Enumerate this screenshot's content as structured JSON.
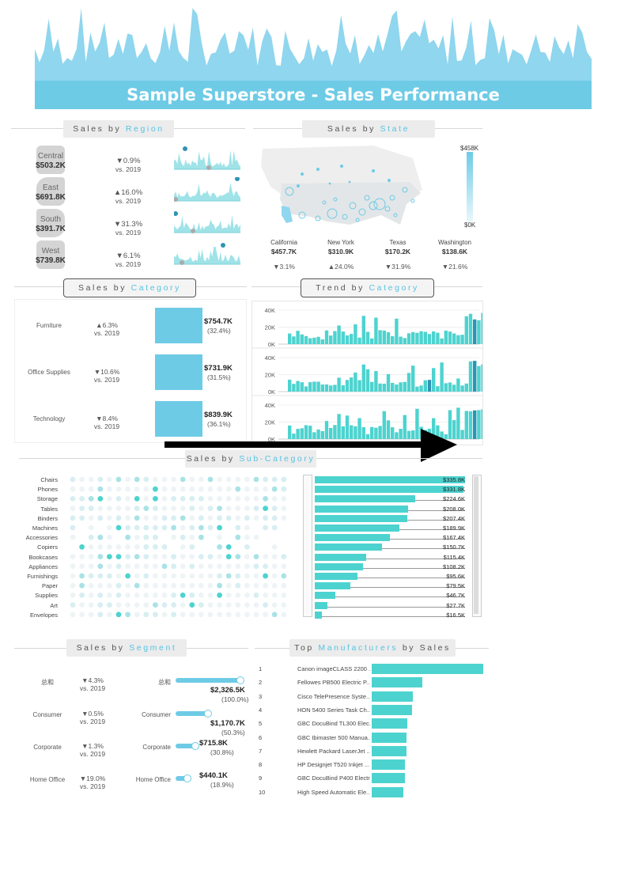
{
  "header": {
    "title": "Sample Superstore - Sales Performance"
  },
  "region": {
    "pill": {
      "a": "Sales  by ",
      "b": "Region"
    },
    "items": [
      {
        "name": "Central",
        "value": "$503.2K",
        "change": "▼0.9%",
        "dir": "down",
        "vs": "vs. 2019"
      },
      {
        "name": "East",
        "value": "$691.8K",
        "change": "▲16.0%",
        "dir": "up",
        "vs": "vs. 2019"
      },
      {
        "name": "South",
        "value": "$391.7K",
        "change": "▼31.3%",
        "dir": "down",
        "vs": "vs. 2019"
      },
      {
        "name": "West",
        "value": "$739.8K",
        "change": "▼6.1%",
        "dir": "down",
        "vs": "vs. 2019"
      }
    ]
  },
  "state": {
    "pill": {
      "a": "Sales  by ",
      "b": "State"
    },
    "legend_max": "$458K",
    "legend_min": "$0K",
    "items": [
      {
        "name": "California",
        "value": "$457.7K",
        "change": "▼3.1%",
        "dir": "down"
      },
      {
        "name": "New York",
        "value": "$310.9K",
        "change": "▲24.0%",
        "dir": "up"
      },
      {
        "name": "Texas",
        "value": "$170.2K",
        "change": "▼31.9%",
        "dir": "down"
      },
      {
        "name": "Washington",
        "value": "$138.6K",
        "change": "▼21.6%",
        "dir": "down"
      }
    ]
  },
  "category": {
    "pill": {
      "a": "Sales  by ",
      "b": "Category"
    },
    "items": [
      {
        "name": "Furniture",
        "change": "▲6.3%",
        "dir": "up",
        "vs": "vs. 2019",
        "value": "$754.7K",
        "pct": "(32.4%)"
      },
      {
        "name": "Office Supplies",
        "change": "▼10.6%",
        "dir": "down",
        "vs": "vs. 2019",
        "value": "$731.9K",
        "pct": "(31.5%)"
      },
      {
        "name": "Technology",
        "change": "▼8.4%",
        "dir": "down",
        "vs": "vs. 2019",
        "value": "$839.9K",
        "pct": "(36.1%)"
      }
    ]
  },
  "trend": {
    "pill": {
      "a": "Trend  by ",
      "b": "Category"
    },
    "ticks": [
      "40K",
      "20K",
      "0K"
    ]
  },
  "subcategory": {
    "pill": {
      "a": "Sales  by ",
      "b": "Sub-Category"
    },
    "items": [
      {
        "name": "Chairs",
        "value": "$335.8K",
        "num": 335.8
      },
      {
        "name": "Phones",
        "value": "$331.8K",
        "num": 331.8
      },
      {
        "name": "Storage",
        "value": "$224.6K",
        "num": 224.6
      },
      {
        "name": "Tables",
        "value": "$208.0K",
        "num": 208.0
      },
      {
        "name": "Binders",
        "value": "$207.4K",
        "num": 207.4
      },
      {
        "name": "Machines",
        "value": "$189.9K",
        "num": 189.9
      },
      {
        "name": "Accessories",
        "value": "$167.4K",
        "num": 167.4
      },
      {
        "name": "Copiers",
        "value": "$150.7K",
        "num": 150.7
      },
      {
        "name": "Bookcases",
        "value": "$115.4K",
        "num": 115.4
      },
      {
        "name": "Appliances",
        "value": "$108.2K",
        "num": 108.2
      },
      {
        "name": "Furnishings",
        "value": "$95.6K",
        "num": 95.6
      },
      {
        "name": "Paper",
        "value": "$79.5K",
        "num": 79.5
      },
      {
        "name": "Supplies",
        "value": "$46.7K",
        "num": 46.7
      },
      {
        "name": "Art",
        "value": "$27.7K",
        "num": 27.7
      },
      {
        "name": "Envelopes",
        "value": "$16.5K",
        "num": 16.5
      }
    ]
  },
  "segment": {
    "pill": {
      "a": "Sales  by ",
      "b": "Segment"
    },
    "items": [
      {
        "name": "总和",
        "change": "▼4.3%",
        "vs": "vs. 2019",
        "value": "$2,326.5K",
        "pct": "(100.0%)",
        "share": 100.0
      },
      {
        "name": "Consumer",
        "change": "▼0.5%",
        "vs": "vs. 2019",
        "value": "$1,170.7K",
        "pct": "(50.3%)",
        "share": 50.3
      },
      {
        "name": "Corporate",
        "change": "▼1.3%",
        "vs": "vs. 2019",
        "value": "$715.8K",
        "pct": "(30.8%)",
        "share": 30.8
      },
      {
        "name": "Home Office",
        "change": "▼19.0%",
        "vs": "vs. 2019",
        "value": "$440.1K",
        "pct": "(18.9%)",
        "share": 18.9
      }
    ]
  },
  "manufacturers": {
    "pill": {
      "a": "Top ",
      "b": "Manufacturers",
      "c": " by  Sales"
    },
    "items": [
      {
        "rank": "1",
        "name": "Canon imageCLASS 2200 ...",
        "share": 1.0
      },
      {
        "rank": "2",
        "name": "Fellowes PB500 Electric P...",
        "share": 0.45
      },
      {
        "rank": "3",
        "name": "Cisco TelePresence Syste...",
        "share": 0.37
      },
      {
        "rank": "4",
        "name": "HON 5400 Series Task Ch...",
        "share": 0.36
      },
      {
        "rank": "5",
        "name": "GBC DocuBind TL300 Elec...",
        "share": 0.32
      },
      {
        "rank": "6",
        "name": "GBC Ibimaster 500 Manua...",
        "share": 0.31
      },
      {
        "rank": "7",
        "name": "Hewlett Packard LaserJet ...",
        "share": 0.31
      },
      {
        "rank": "8",
        "name": "HP Designjet T520 Inkjet ...",
        "share": 0.3
      },
      {
        "rank": "9",
        "name": "GBC DocuBind P400 Electr...",
        "share": 0.3
      },
      {
        "rank": "10",
        "name": "High Speed Automatic Ele...",
        "share": 0.28
      }
    ]
  },
  "colors": {
    "accent": "#6ecbe6",
    "teal": "#4dd3cf",
    "up": "#3ea34b",
    "down": "#d9534f"
  }
}
